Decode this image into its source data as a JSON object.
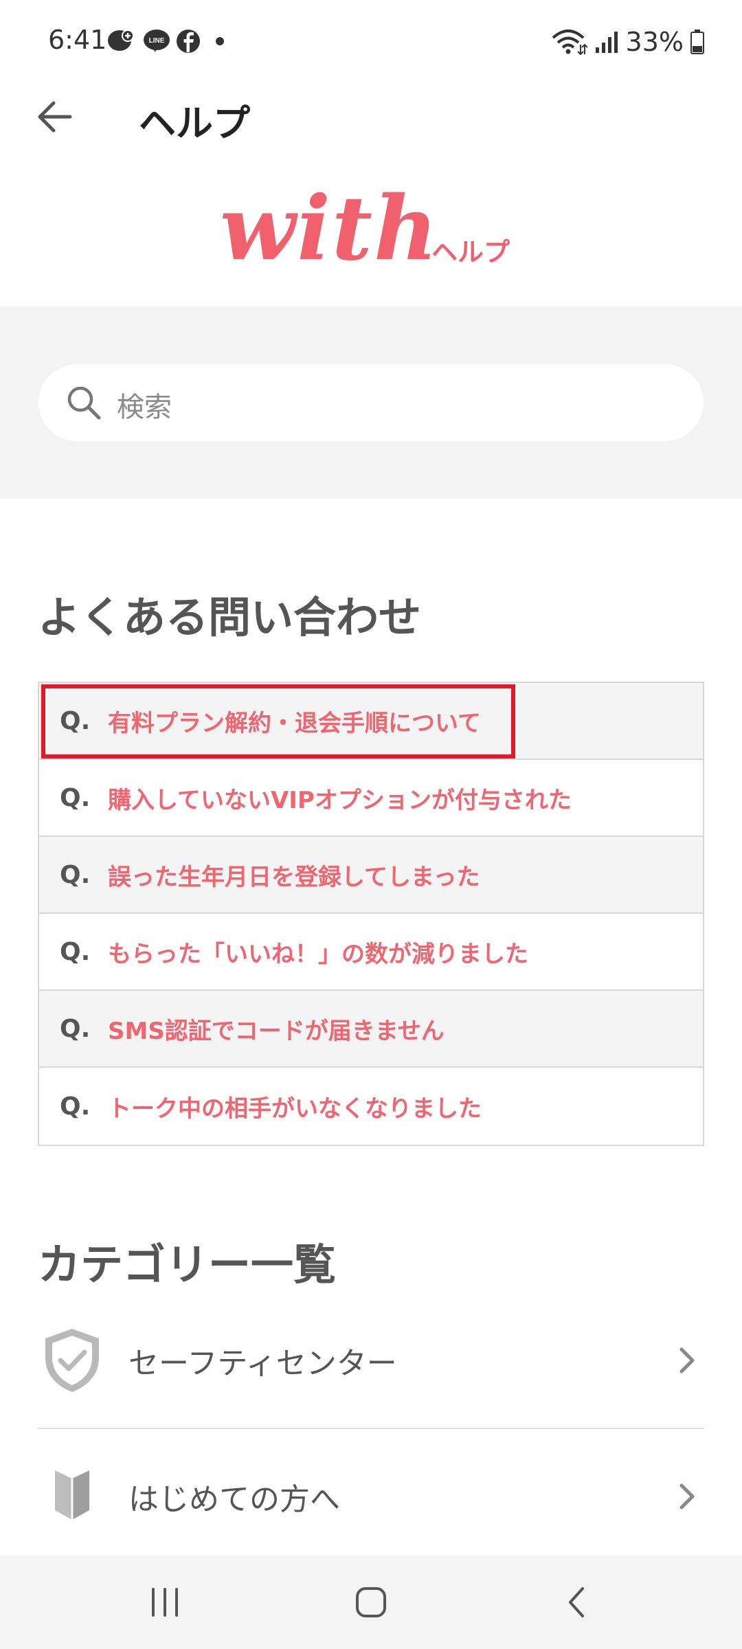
{
  "status_bar": {
    "time": "6:41",
    "battery": "33%",
    "app_icons": [
      "messenger-icon",
      "line-icon",
      "facebook-icon"
    ]
  },
  "header": {
    "title": "ヘルプ",
    "back_icon": "arrow-left-icon"
  },
  "logo": {
    "wordmark": "with",
    "sub": "ヘルプ",
    "color": "#f0606d"
  },
  "search": {
    "placeholder": "検索"
  },
  "faq": {
    "title": "よくある問い合わせ",
    "q_prefix": "Q.",
    "items": [
      "有料プラン解約・退会手順について",
      "購入していないVIPオプションが付与された",
      "誤った生年月日を登録してしまった",
      "もらった「いいね！」の数が減りました",
      "SMS認証でコードが届きません",
      "トーク中の相手がいなくなりました"
    ],
    "highlighted_index": 0,
    "highlight_color": "#e0192d"
  },
  "categories": {
    "title": "カテゴリー一覧",
    "items": [
      {
        "label": "セーフティセンター",
        "icon": "shield-check-icon"
      },
      {
        "label": "はじめての方へ",
        "icon": "beginner-mark-icon"
      }
    ]
  },
  "nav_bar": {
    "buttons": [
      "recent-apps-icon",
      "home-icon",
      "back-icon"
    ]
  }
}
